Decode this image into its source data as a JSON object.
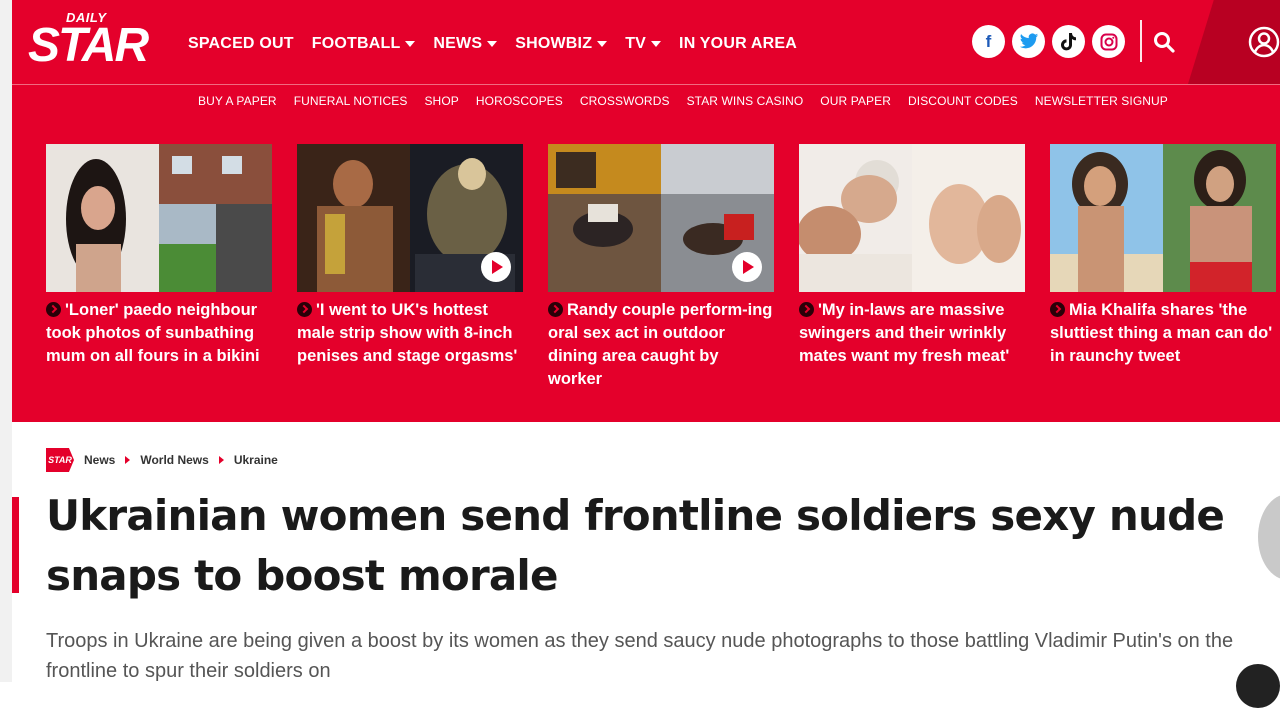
{
  "masthead": {
    "logo": {
      "top": "DAILY",
      "main": "STAR"
    },
    "nav": [
      {
        "label": "SPACED OUT",
        "has_dropdown": false
      },
      {
        "label": "FOOTBALL",
        "has_dropdown": true
      },
      {
        "label": "NEWS",
        "has_dropdown": true
      },
      {
        "label": "SHOWBIZ",
        "has_dropdown": true
      },
      {
        "label": "TV",
        "has_dropdown": true
      },
      {
        "label": "IN YOUR AREA",
        "has_dropdown": false
      }
    ],
    "social_icons": [
      "facebook-icon",
      "twitter-icon",
      "tiktok-icon",
      "instagram-icon"
    ],
    "search_icon": "search-icon",
    "account_icon": "account-icon"
  },
  "subnav": [
    "BUY A PAPER",
    "FUNERAL NOTICES",
    "SHOP",
    "HOROSCOPES",
    "CROSSWORDS",
    "STAR WINS CASINO",
    "OUR PAPER",
    "DISCOUNT CODES",
    "NEWSLETTER SIGNUP"
  ],
  "promo": [
    {
      "headline": "'Loner' paedo neighbour took photos of sunbathing mum on all fours in a bikini",
      "video": false
    },
    {
      "headline": "'I went to UK's hottest male strip show with 8-inch penises and stage orgasms'",
      "video": true
    },
    {
      "headline": "Randy couple perform-ing oral sex act in outdoor dining area caught by worker",
      "video": true
    },
    {
      "headline": "'My in-laws are massive swingers and their wrinkly mates want my fresh meat'",
      "video": false
    },
    {
      "headline": "Mia Khalifa shares 'the sluttiest thing a man can do' in raunchy tweet",
      "video": false
    }
  ],
  "article": {
    "breadcrumb_logo": "STAR",
    "breadcrumb": [
      "News",
      "World News",
      "Ukraine"
    ],
    "title": "Ukrainian women send frontline soldiers sexy nude snaps to boost morale",
    "standfirst": "Troops in Ukraine are being given a boost by its women as they send saucy nude photographs to those battling Vladimir Putin's on the frontline to spur their soldiers on"
  },
  "colors": {
    "brand_red": "#e4002b",
    "dark_red": "#b80022",
    "text": "#1a1a1a",
    "muted": "#555555"
  }
}
